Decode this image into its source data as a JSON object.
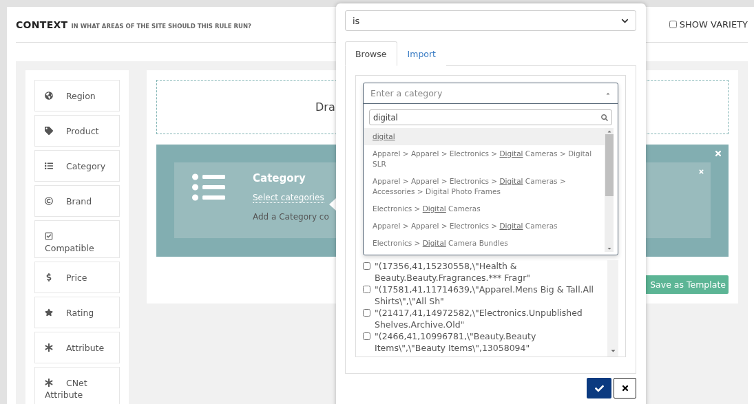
{
  "header": {
    "title": "CONTEXT",
    "subtitle": "IN WHAT AREAS OF THE SITE SHOULD THIS RULE RUN?",
    "show_variety": {
      "label": "SHOW VARIETY",
      "checked": false
    }
  },
  "sidebar": {
    "items": [
      {
        "label": "Region"
      },
      {
        "label": "Product"
      },
      {
        "label": "Category"
      },
      {
        "label": "Brand"
      },
      {
        "label": "Compatible"
      },
      {
        "label": "Price"
      },
      {
        "label": "Rating"
      },
      {
        "label": "Attribute"
      },
      {
        "label": "CNet Attribute"
      }
    ]
  },
  "drop_zone": {
    "text": "Dra"
  },
  "rule_card": {
    "title": "Category",
    "link": "Select categories",
    "hint": "Add a Category co"
  },
  "save_template_button": "Save as Template",
  "popover": {
    "operator": "is",
    "tabs": [
      {
        "label": "Browse",
        "selected": true
      },
      {
        "label": "Import",
        "selected": false
      }
    ],
    "category_select": {
      "placeholder": "Enter a category",
      "expanded": true,
      "search": "digital",
      "options": [
        {
          "match": "digital",
          "selected": true
        },
        {
          "prefix": "Apparel > Apparel > Electronics > ",
          "match": "Digital",
          "suffix": " Cameras > Digital SLR",
          "selected": false
        },
        {
          "prefix": "Apparel > Apparel > Electronics > ",
          "match": "Digital",
          "suffix": " Cameras > Accessories > Digital Photo Frames",
          "selected": false
        },
        {
          "prefix": "Electronics > ",
          "match": "Digital",
          "suffix": " Cameras",
          "selected": false
        },
        {
          "prefix": "Apparel > Apparel > Electronics > ",
          "match": "Digital",
          "suffix": " Cameras",
          "selected": false
        },
        {
          "prefix": "Electronics > ",
          "match": "Digital",
          "suffix": " Camera Bundles",
          "selected": false
        }
      ]
    },
    "list": [
      {
        "label": "\"(17356,41,15230558,\\\"Health & Beauty.Beauty.Fragrances.*** Fragr\"",
        "checked": false
      },
      {
        "label": "\"(17581,41,11714639,\\\"Apparel.Mens Big & Tall.All Shirts\\\",\\\"All Sh\"",
        "checked": false
      },
      {
        "label": "\"(21417,41,14972582,\\\"Electronics.Unpublished Shelves.Archive.Old\"",
        "checked": false
      },
      {
        "label": "\"(2466,41,10996781,\\\"Beauty.Beauty Items\\\",\\\"Beauty Items\\\",13058094\"",
        "checked": false
      }
    ]
  }
}
